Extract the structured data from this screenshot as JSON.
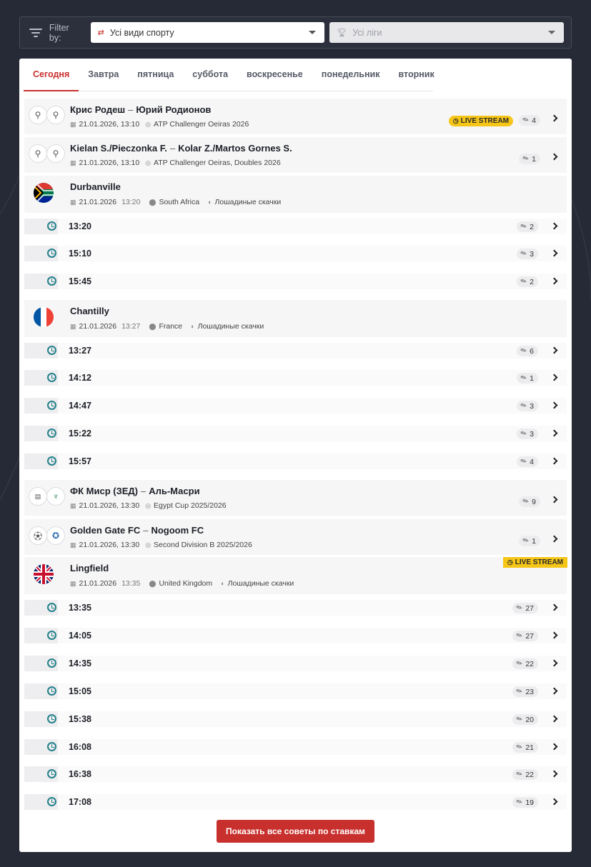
{
  "filter": {
    "label": "Filter by:",
    "sport_select": "Усі види спорту",
    "league_select": "Усі ліги"
  },
  "tabs": [
    {
      "label": "Сегодня",
      "active": true
    },
    {
      "label": "Завтра"
    },
    {
      "label": "пятница"
    },
    {
      "label": "суббота"
    },
    {
      "label": "воскресенье"
    },
    {
      "label": "понедельник"
    },
    {
      "label": "вторник"
    }
  ],
  "matches": {
    "m1": {
      "team1": "Крис Родеш",
      "team2": "Юрий Родионов",
      "date": "21.01.2026, 13:10",
      "league": "ATP Challenger Oeiras 2026",
      "live": "LIVE STREAM",
      "tips": "4"
    },
    "m2": {
      "team1": "Kielan S./Pieczonka F.",
      "team2": "Kolar Z./Martos Gornes S.",
      "date": "21.01.2026, 13:10",
      "league": "ATP Challenger Oeiras, Doubles 2026",
      "tips": "1"
    },
    "m3": {
      "team1": "ФК Миср (ЗЕД)",
      "team2": "Аль-Масри",
      "date": "21.01.2026, 13:30",
      "league": "Egypt Cup 2025/2026",
      "tips": "9"
    },
    "m4": {
      "team1": "Golden Gate FC",
      "team2": "Nogoom FC",
      "date": "21.01.2026, 13:30",
      "league": "Second Division B 2025/2026",
      "tips": "1"
    }
  },
  "separator": "–",
  "venues": {
    "durbanville": {
      "name": "Durbanville",
      "date": "21.01.2026",
      "time": "13:20",
      "country": "South Africa",
      "sport": "Лошадиные скачки",
      "races": [
        {
          "time": "13:20",
          "tips": "2"
        },
        {
          "time": "15:10",
          "tips": "3"
        },
        {
          "time": "15:45",
          "tips": "2"
        }
      ]
    },
    "chantilly": {
      "name": "Chantilly",
      "date": "21.01.2026",
      "time": "13:27",
      "country": "France",
      "sport": "Лошадиные скачки",
      "races": [
        {
          "time": "13:27",
          "tips": "6"
        },
        {
          "time": "14:12",
          "tips": "1"
        },
        {
          "time": "14:47",
          "tips": "3"
        },
        {
          "time": "15:22",
          "tips": "3"
        },
        {
          "time": "15:57",
          "tips": "4"
        }
      ]
    },
    "lingfield": {
      "name": "Lingfield",
      "date": "21.01.2026",
      "time": "13:35",
      "country": "United Kingdom",
      "sport": "Лошадиные скачки",
      "live": "LIVE STREAM",
      "races": [
        {
          "time": "13:35",
          "tips": "27"
        },
        {
          "time": "14:05",
          "tips": "27"
        },
        {
          "time": "14:35",
          "tips": "22"
        },
        {
          "time": "15:05",
          "tips": "23"
        },
        {
          "time": "15:38",
          "tips": "20"
        },
        {
          "time": "16:08",
          "tips": "21"
        },
        {
          "time": "16:38",
          "tips": "22"
        },
        {
          "time": "17:08",
          "tips": "19"
        }
      ]
    }
  },
  "show_all_button": "Показать все советы по ставкам",
  "colors": {
    "accent": "#c8302d",
    "live": "#f5c518",
    "clock": "#24808a",
    "background": "#262a36"
  }
}
